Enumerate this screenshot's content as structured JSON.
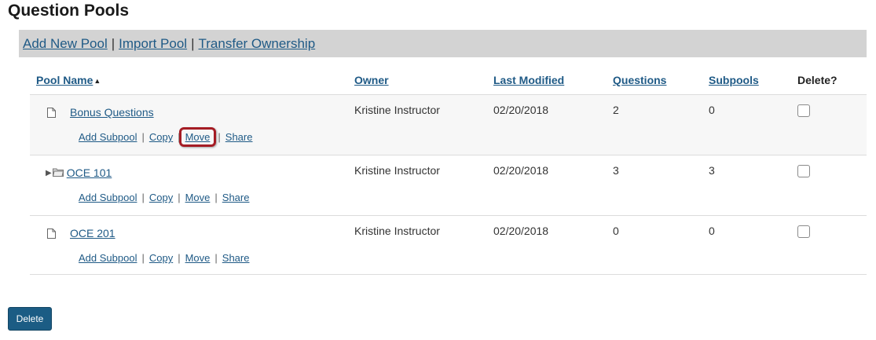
{
  "page": {
    "title": "Question Pools"
  },
  "toolbar": {
    "links": [
      "Add New Pool",
      "Import Pool",
      "Transfer Ownership"
    ],
    "separator": "|"
  },
  "table": {
    "headers": {
      "pool_name": "Pool Name",
      "owner": "Owner",
      "last_modified": "Last Modified",
      "questions": "Questions",
      "subpools": "Subpools",
      "delete": "Delete?"
    },
    "sort_indicator": "▲",
    "actions": [
      "Add Subpool",
      "Copy",
      "Move",
      "Share"
    ],
    "action_separator": "|",
    "rows": [
      {
        "name": "Bonus Questions",
        "owner": "Kristine Instructor",
        "last_modified": "02/20/2018",
        "questions": "2",
        "subpools": "0",
        "icon": "file-icon",
        "highlighted_action": "Move"
      },
      {
        "name": "OCE 101",
        "owner": "Kristine Instructor",
        "last_modified": "02/20/2018",
        "questions": "3",
        "subpools": "3",
        "icon": "folder-icon",
        "expandable": true
      },
      {
        "name": "OCE 201",
        "owner": "Kristine Instructor",
        "last_modified": "02/20/2018",
        "questions": "0",
        "subpools": "0",
        "icon": "file-icon"
      }
    ]
  },
  "footer": {
    "delete_label": "Delete"
  },
  "colors": {
    "link": "#1f5a86",
    "toolbar_bg": "#d3d3d3",
    "highlight": "#a51c24",
    "button": "#1b5c84"
  }
}
